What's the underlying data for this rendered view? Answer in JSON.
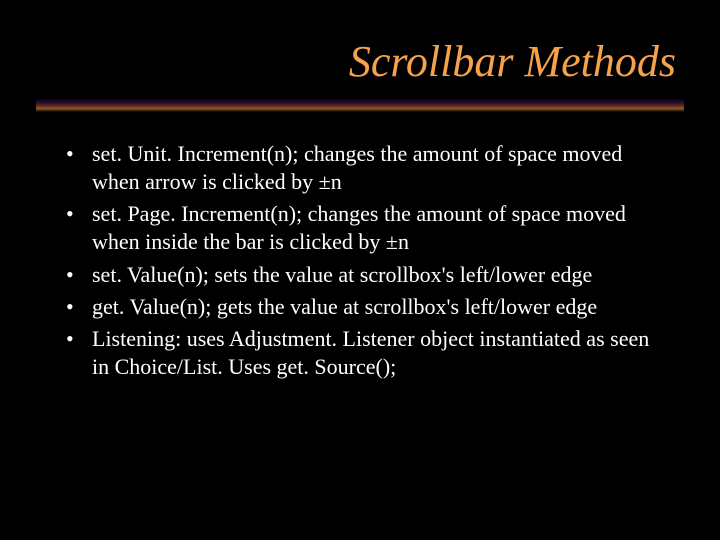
{
  "title": "Scrollbar Methods",
  "bullets": [
    "set. Unit. Increment(n);  changes the amount of space moved when arrow is clicked by ±n",
    "set. Page. Increment(n);  changes the amount of space moved when inside the bar is clicked by ±n",
    "set. Value(n);  sets the value at scrollbox's left/lower edge",
    "get. Value(n);  gets the value at scrollbox's left/lower edge",
    "Listening:  uses Adjustment. Listener object instantiated as seen in Choice/List.  Uses get. Source();"
  ]
}
